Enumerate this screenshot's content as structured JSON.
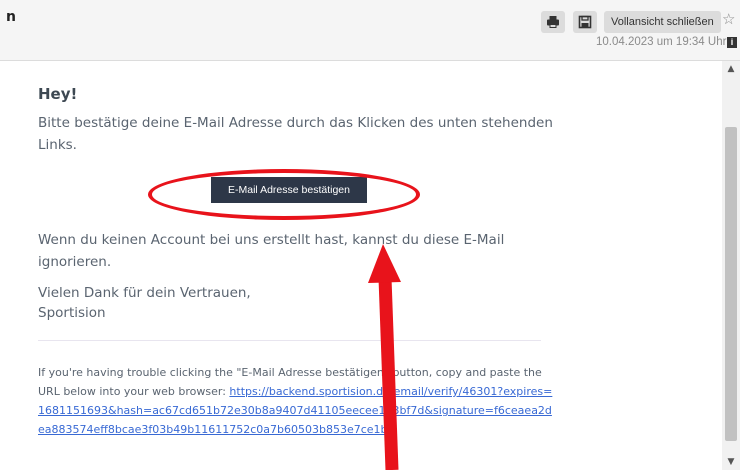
{
  "header": {
    "subject_fragment": "n",
    "print_icon": "printer-icon",
    "save_icon": "save-icon",
    "close_fullview_label": "Vollansicht schließen",
    "star_icon": "star-icon",
    "date": "10.04.2023 um 19:34 Uhr",
    "info_icon": "info-icon"
  },
  "email": {
    "greeting": "Hey!",
    "intro": "Bitte bestätige deine E-Mail Adresse durch das Klicken des unten stehenden Links.",
    "button_label": "E-Mail Adresse bestätigen",
    "no_account": "Wenn du keinen Account bei uns erstellt hast, kannst du diese E-Mail ignorieren.",
    "thanks_line": "Vielen Dank für dein Vertrauen,",
    "signature": "Sportision",
    "subcopy_text": "If you're having trouble clicking the \"E-Mail Adresse bestätigen\" button, copy and paste the URL below into your web browser: ",
    "link_text": "https://backend.sportision.de/email/verify/46301?expires=1681151693&hash=ac67cd651b72e30b8a9407d41105eecee173bf7d&signature=f6ceaea2dea883574eff8bcae3f03b49b11611752c0a7b60503b853e7ce1b8"
  },
  "annotations": {
    "circle_color": "#e8131b",
    "arrow_color": "#e8131b"
  },
  "colors": {
    "button_bg": "#2d3748",
    "link": "#3869d4",
    "body_text": "#5a6470"
  }
}
